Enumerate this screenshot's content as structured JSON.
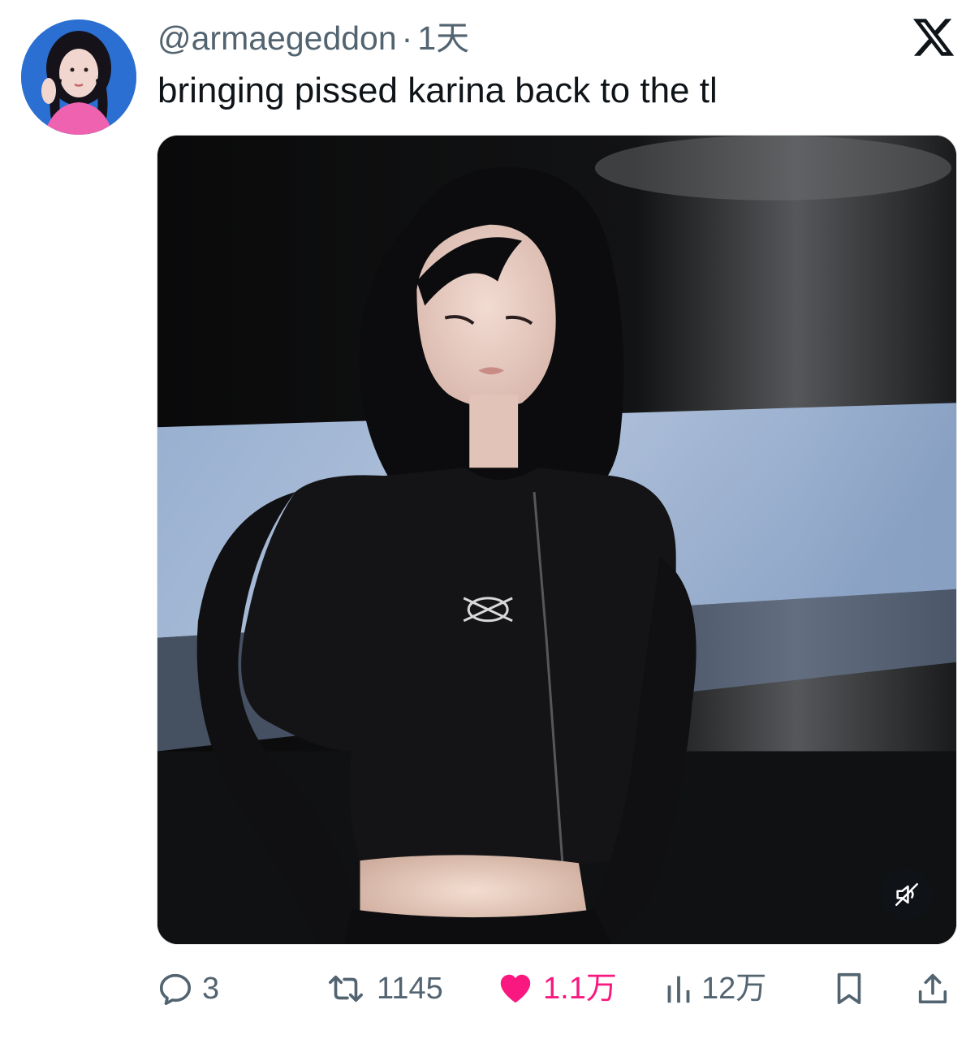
{
  "author": {
    "handle": "@armaegeddon",
    "separator": "·",
    "time": "1天"
  },
  "tweet": {
    "text": "bringing pissed karina back to the tl"
  },
  "header": {
    "logo_icon": "x-logo-icon"
  },
  "media": {
    "type": "video",
    "mute_icon": "muted-speaker-icon"
  },
  "actions": {
    "reply_count": "3",
    "retweet_count": "1145",
    "like_count": "1.1万",
    "views_count": "12万",
    "liked": true
  },
  "colors": {
    "text_primary": "#0f1419",
    "text_secondary": "#536471",
    "like_pink": "#f91880",
    "avatar_bg": "#2a6fd1"
  }
}
